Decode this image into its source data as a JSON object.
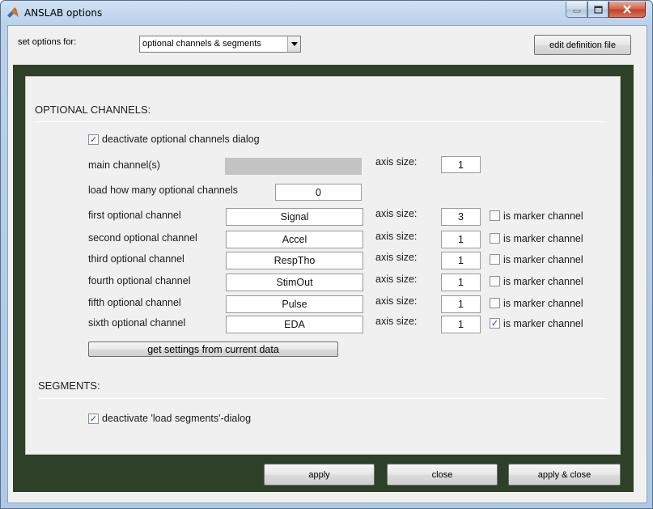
{
  "window": {
    "title": "ANSLAB options",
    "controls": {
      "minimize": "minimize",
      "maximize": "maximize",
      "close": "close"
    }
  },
  "top": {
    "set_options_label": "set options for:",
    "select_value": "optional channels & segments",
    "edit_button": "edit definition file"
  },
  "optional_channels": {
    "heading": "OPTIONAL CHANNELS:",
    "deactivate_label": "deactivate optional channels dialog",
    "deactivate_checked": true,
    "main_channel_label": "main channel(s)",
    "main_channel_value": "",
    "main_axis_label": "axis size:",
    "main_axis_value": "1",
    "load_count_label": "load how many optional channels",
    "load_count_value": "0",
    "rows": [
      {
        "label": "first optional channel",
        "name": "Signal",
        "axis_label": "axis size:",
        "axis": "3",
        "marker_label": "is marker channel",
        "marker": false
      },
      {
        "label": "second optional channel",
        "name": "Accel",
        "axis_label": "axis size:",
        "axis": "1",
        "marker_label": "is marker channel",
        "marker": false
      },
      {
        "label": "third optional channel",
        "name": "RespTho",
        "axis_label": "axis size:",
        "axis": "1",
        "marker_label": "is marker channel",
        "marker": false
      },
      {
        "label": "fourth optional channel",
        "name": "StimOut",
        "axis_label": "axis size:",
        "axis": "1",
        "marker_label": "is marker channel",
        "marker": false
      },
      {
        "label": "fifth optional channel",
        "name": "Pulse",
        "axis_label": "axis size:",
        "axis": "1",
        "marker_label": "is marker channel",
        "marker": false
      },
      {
        "label": "sixth optional channel",
        "name": "EDA",
        "axis_label": "axis size:",
        "axis": "1",
        "marker_label": "is marker channel",
        "marker": true
      }
    ],
    "get_settings_button": "get settings from current data"
  },
  "segments": {
    "heading": "SEGMENTS:",
    "deactivate_label": "deactivate 'load segments'-dialog",
    "deactivate_checked": true
  },
  "footer": {
    "apply": "apply",
    "close": "close",
    "apply_close": "apply & close"
  },
  "colors": {
    "panel_green": "#2e4028",
    "client_bg": "#f0f0f0",
    "checkmark": "#2a4a8a"
  },
  "icons": {
    "app": "matlab-logo-icon",
    "minimize": "minimize-icon",
    "maximize": "maximize-icon",
    "close": "close-icon",
    "dropdown": "chevron-down-icon",
    "checkbox": "checkmark-icon"
  }
}
